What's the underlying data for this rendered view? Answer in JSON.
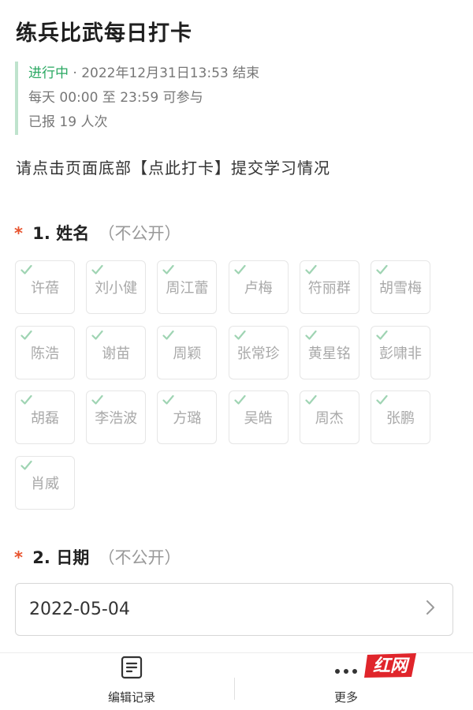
{
  "header": {
    "title": "练兵比武每日打卡"
  },
  "meta": {
    "status": "进行中",
    "end_info": "· 2022年12月31日13:53 结束",
    "time_window": "每天 00:00 至 23:59 可参与",
    "count": "已报 19 人次"
  },
  "description": "请点击页面底部【点此打卡】提交学习情况",
  "question1": {
    "required_mark": "*",
    "label": "1. 姓名",
    "note": "（不公开）",
    "options": [
      "许蓓",
      "刘小健",
      "周江蕾",
      "卢梅",
      "符丽群",
      "胡雪梅",
      "陈浩",
      "谢苗",
      "周颖",
      "张常珍",
      "黄星铭",
      "彭啸非",
      "胡磊",
      "李浩波",
      "方璐",
      "吴皓",
      "周杰",
      "张鹏",
      "肖威"
    ]
  },
  "question2": {
    "required_mark": "*",
    "label": "2. 日期",
    "note": "（不公开）",
    "value": "2022-05-04"
  },
  "bottom_bar": {
    "edit_label": "编辑记录",
    "more_label": "更多"
  },
  "watermark": {
    "text": "红网",
    "color": "#e0252b"
  },
  "colors": {
    "accent_green": "#2aa862",
    "required_red": "#e8542f",
    "check_green": "#9fd4b3"
  },
  "icons": {
    "option_check": "check-icon",
    "date_chevron": "chevron-right-icon",
    "edit": "edit-document-icon",
    "more": "more-dots-icon"
  }
}
